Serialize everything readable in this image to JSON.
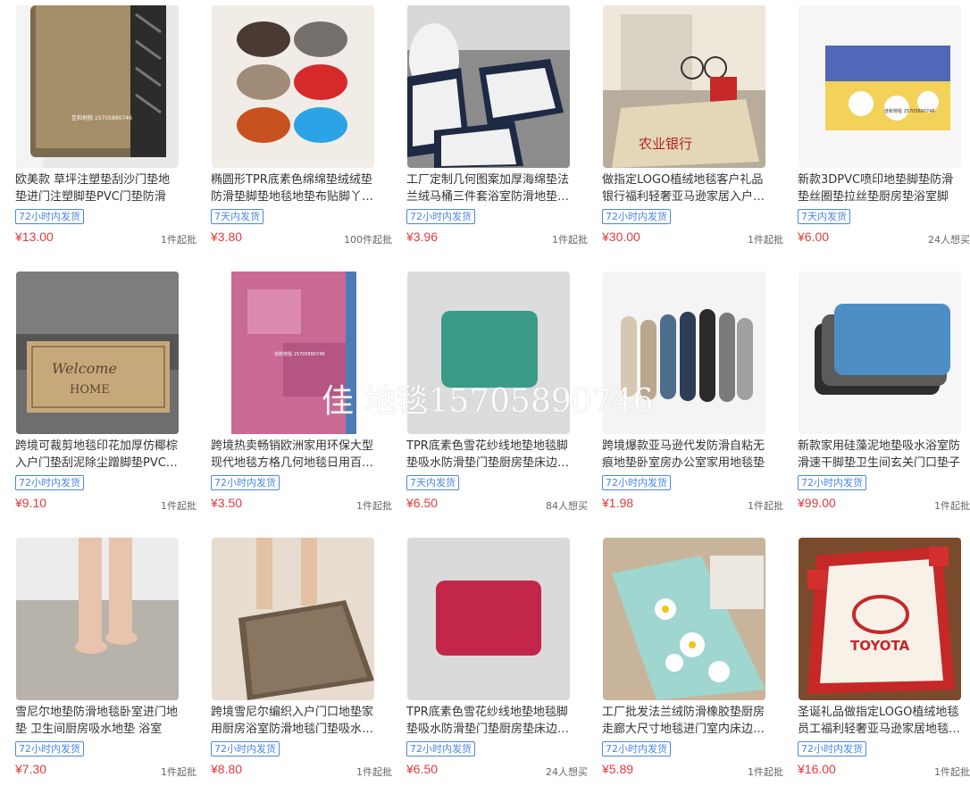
{
  "watermark": "佳 地毯15705890746",
  "products": [
    {
      "title": "欧美款 草坪注塑垫刮沙门垫地垫进门注塑脚垫PVC门垫防滑地…",
      "tag": "72小时内发货",
      "price": "¥13.00",
      "moq": "1件起批",
      "thumb_text": "佳和地毯 15705890746"
    },
    {
      "title": "椭圆形TPR底素色绵绵垫绒绒垫防滑垫脚垫地毯地垫布贴脚丫…",
      "tag": "7天内发货",
      "price": "¥3.80",
      "moq": "100件起批",
      "thumb_text": ""
    },
    {
      "title": "工厂定制几何图案加厚海绵垫法兰绒马桶三件套浴室防滑地垫…",
      "tag": "72小时内发货",
      "price": "¥3.96",
      "moq": "1件起批",
      "thumb_text": ""
    },
    {
      "title": "做指定LOGO植绒地毯客户礼品银行福利轻奢亚马逊家居入户…",
      "tag": "72小时内发货",
      "price": "¥30.00",
      "moq": "1件起批",
      "thumb_text": "农业银行"
    },
    {
      "title": "新款3DPVC喷印地垫脚垫防滑垫丝圈垫拉丝垫厨房垫浴室脚垫…",
      "tag": "7天内发货",
      "price": "¥6.00",
      "moq": "24人想买",
      "thumb_text": "佳和地毯 15705890746"
    },
    {
      "title": "跨境可裁剪地毯印花加厚仿椰棕入户门垫刮泥除尘蹭脚垫PVC…",
      "tag": "72小时内发货",
      "price": "¥9.10",
      "moq": "1件起批",
      "thumb_text": "Welcome HOME"
    },
    {
      "title": "跨境热卖畅销欧洲家用环保大型现代地毯方格几何地毯日用百…",
      "tag": "72小时内发货",
      "price": "¥3.50",
      "moq": "1件起批",
      "thumb_text": "佳和地毯 15705890746"
    },
    {
      "title": "TPR底素色雪花纱线地垫地毯脚垫吸水防滑垫门垫厨房垫床边…",
      "tag": "7天内发货",
      "price": "¥6.50",
      "moq": "84人想买",
      "thumb_text": ""
    },
    {
      "title": "跨境爆款亚马逊代发防滑自粘无痕地垫卧室房办公室家用地毯垫",
      "tag": "72小时内发货",
      "price": "¥1.98",
      "moq": "1件起批",
      "thumb_text": ""
    },
    {
      "title": "新款家用硅藻泥地垫吸水浴室防滑速干脚垫卫生间玄关门口垫子",
      "tag": "72小时内发货",
      "price": "¥99.00",
      "moq": "1件起批",
      "thumb_text": ""
    },
    {
      "title": "雪尼尔地垫防滑地毯卧室进门地垫 卫生间厨房吸水地垫 浴室防…",
      "tag": "72小时内发货",
      "price": "¥7.30",
      "moq": "1件起批",
      "thumb_text": ""
    },
    {
      "title": "跨境雪尼尔编织入户门口地垫家用厨房浴室防滑地毯门垫吸水…",
      "tag": "72小时内发货",
      "price": "¥8.80",
      "moq": "1件起批",
      "thumb_text": ""
    },
    {
      "title": "TPR底素色雪花纱线地垫地毯脚垫吸水防滑垫门垫厨房垫床边…",
      "tag": "72小时内发货",
      "price": "¥6.50",
      "moq": "24人想买",
      "thumb_text": ""
    },
    {
      "title": "工厂批发法兰绒防滑橡胶垫厨房走廊大尺寸地毯进门室内床边…",
      "tag": "72小时内发货",
      "price": "¥5.89",
      "moq": "1件起批",
      "thumb_text": ""
    },
    {
      "title": "圣诞礼品做指定LOGO植绒地毯员工福利轻奢亚马逊家居地毯…",
      "tag": "72小时内发货",
      "price": "¥16.00",
      "moq": "1件起批",
      "thumb_text": "TOYOTA"
    }
  ]
}
